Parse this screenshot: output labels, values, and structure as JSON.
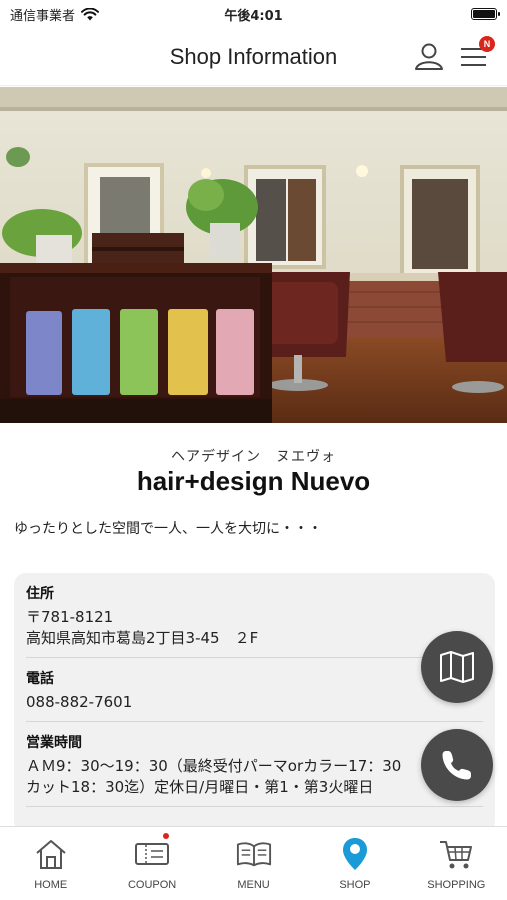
{
  "status_bar": {
    "carrier": "通信事業者",
    "time": "午後4:01",
    "battery_level": 1.0
  },
  "header": {
    "title": "Shop Information",
    "menu_badge": "N"
  },
  "hero": {
    "image_icon": "salon-interior-photo"
  },
  "shop": {
    "kana": "ヘアデザイン　ヌエヴォ",
    "name": "hair+design Nuevo",
    "catchphrase": "ゆったりとした空間で一人、一人を大切に・・・"
  },
  "info": {
    "address_label": "住所",
    "address_zip": "〒781-8121",
    "address_line": "高知県高知市葛島2丁目3-45　２F",
    "phone_label": "電話",
    "phone_value": "088-882-7601",
    "hours_label": "営業時間",
    "hours_line1": "ＡＭ9：30〜19：30（最終受付パーマorカラー17：30",
    "hours_line2": "カット18：30迄）定休日/月曜日・第1・第3火曜日"
  },
  "fabs": {
    "map_icon": "map-icon",
    "phone_icon": "phone-icon"
  },
  "tabs": [
    {
      "label": "HOME",
      "icon": "home-icon"
    },
    {
      "label": "COUPON",
      "icon": "coupon-icon"
    },
    {
      "label": "MENU",
      "icon": "book-icon"
    },
    {
      "label": "SHOP",
      "icon": "location-pin-icon"
    },
    {
      "label": "SHOPPING",
      "icon": "cart-icon"
    }
  ],
  "colors": {
    "accent": "#1a9bd7",
    "badge": "#d9261c",
    "fab": "#4a4a4a"
  }
}
